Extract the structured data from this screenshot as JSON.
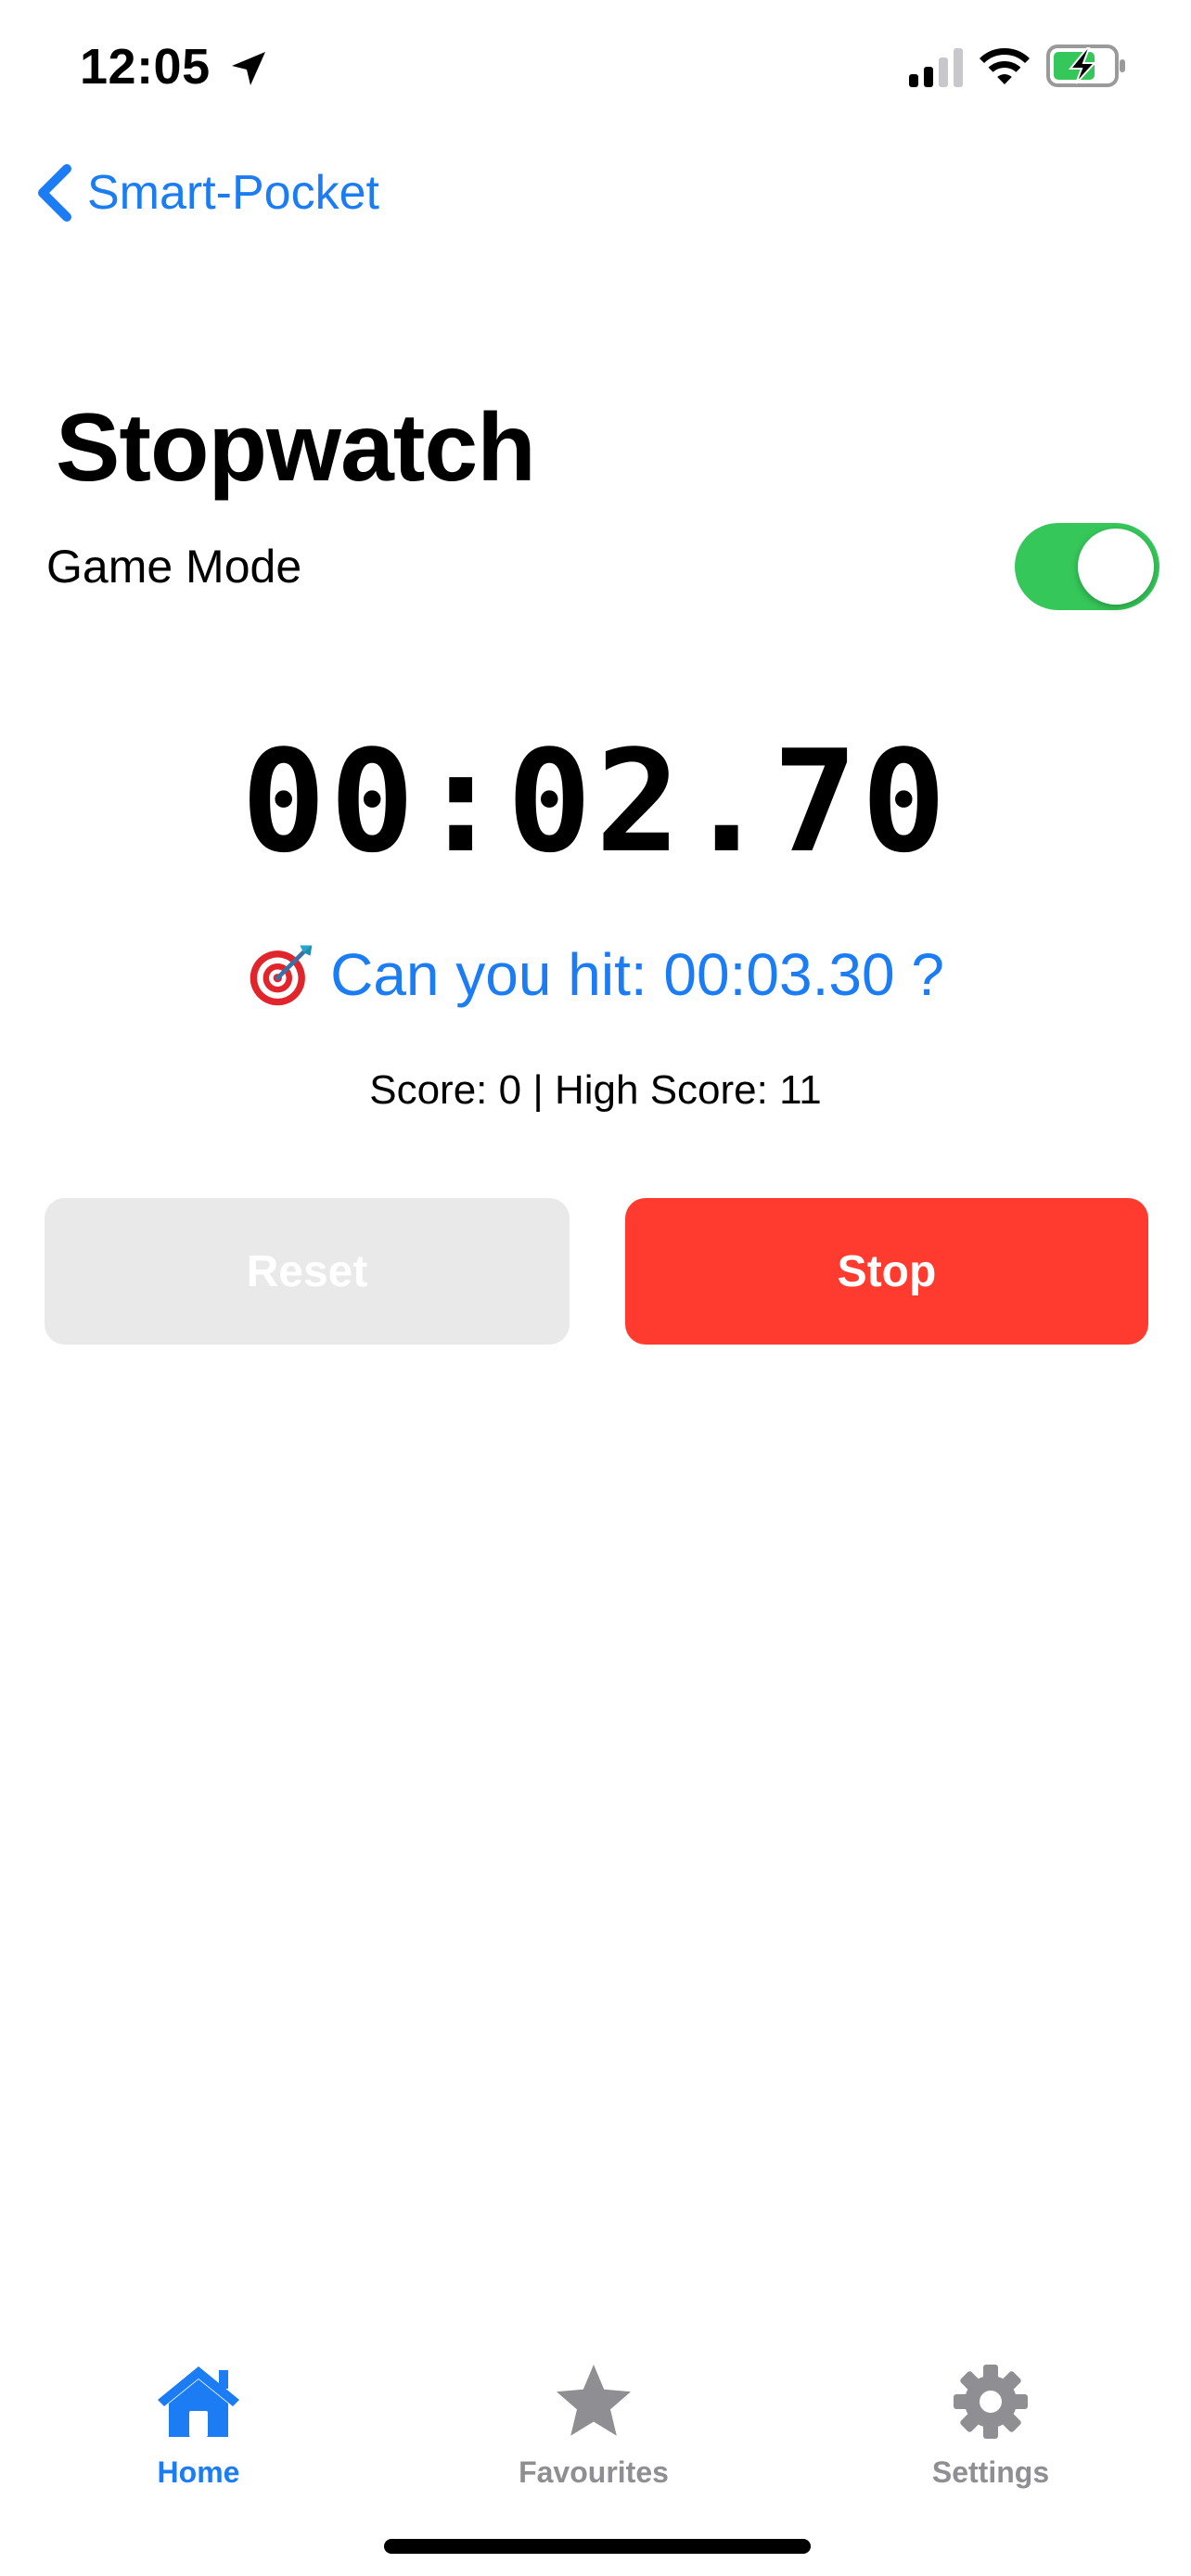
{
  "status_bar": {
    "time": "12:05",
    "icons": [
      "location-arrow-icon",
      "cellular-signal-icon",
      "wifi-icon",
      "battery-charging-icon"
    ]
  },
  "nav": {
    "back_label": "Smart-Pocket",
    "back_icon": "chevron-left-icon"
  },
  "page": {
    "title": "Stopwatch",
    "game_mode_label": "Game Mode",
    "game_mode_on": true
  },
  "stopwatch": {
    "time": "00:02.70",
    "challenge_icon": "target-dart-icon",
    "challenge_text": "Can you hit: 00:03.30 ?",
    "score_text": "Score: 0 | High Score: 11"
  },
  "buttons": {
    "reset_label": "Reset",
    "stop_label": "Stop"
  },
  "tabs": [
    {
      "label": "Home",
      "icon": "house-icon",
      "active": true
    },
    {
      "label": "Favourites",
      "icon": "star-icon",
      "active": false
    },
    {
      "label": "Settings",
      "icon": "gear-icon",
      "active": false
    }
  ],
  "colors": {
    "accent": "#1c7cf4",
    "toggle_on": "#35c759",
    "stop": "#ff3b30",
    "reset_disabled": "#e9e9e9",
    "tab_inactive": "#8e8e93"
  }
}
